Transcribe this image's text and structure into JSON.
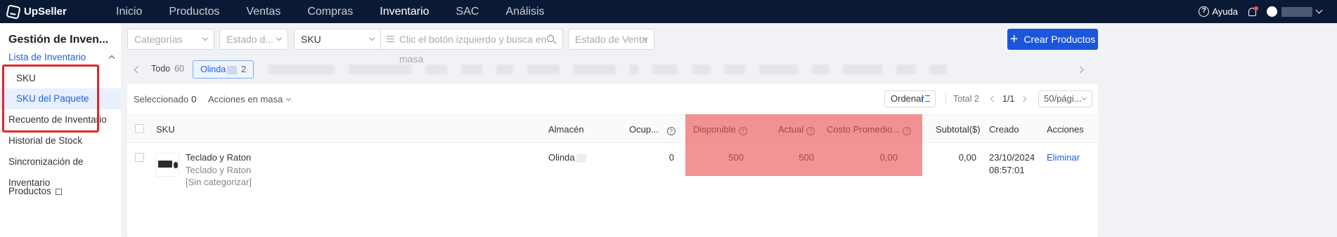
{
  "app": {
    "name": "UpSeller"
  },
  "topnav": {
    "items": [
      "Inicio",
      "Productos",
      "Ventas",
      "Compras",
      "Inventario",
      "SAC",
      "Análisis"
    ],
    "active": "Inventario",
    "help": "Ayuda"
  },
  "sidebar": {
    "title": "Gestión de Inven...",
    "group": "Lista de Inventario",
    "sub_items": [
      "SKU",
      "SKU del Paquete"
    ],
    "items": [
      "Recuento de Inventario",
      "Historial de Stock",
      "Sincronización de Inventario",
      "Productos"
    ]
  },
  "filters": {
    "categories": "Categorías",
    "status": "Estado d...",
    "search_type": "SKU",
    "search_placeholder": "Clic el botón izquierdo y busca en masa",
    "sale_status": "Estado de Venta",
    "create_button": "Crear Productos"
  },
  "tabs": {
    "all_label": "Todo",
    "all_count": "60",
    "active_label": "Olinda",
    "active_count": "2"
  },
  "toolbar": {
    "selected_label": "Seleccionado",
    "selected_count": "0",
    "bulk_actions": "Acciones en masa",
    "sort": "Ordenar",
    "total": "Total 2",
    "page": "1/1",
    "per_page": "50/pági..."
  },
  "table": {
    "headers": {
      "sku": "SKU",
      "warehouse": "Almacén",
      "occupied": "Ocup...",
      "available": "Disponible",
      "actual": "Actual",
      "avg_cost": "Costo Promedio...",
      "subtotal": "Subtotal($)",
      "created": "Creado",
      "actions": "Acciones"
    },
    "rows": [
      {
        "name": "Teclado y Raton",
        "sku": "Teclado y Raton",
        "category": "[Sin categorizar]",
        "warehouse": "Olinda",
        "occupied": "0",
        "available": "500",
        "actual": "500",
        "avg_cost": "0,00",
        "subtotal": "0,00",
        "created_date": "23/10/2024",
        "created_time": "08:57:01",
        "action": "Eliminar"
      }
    ]
  }
}
